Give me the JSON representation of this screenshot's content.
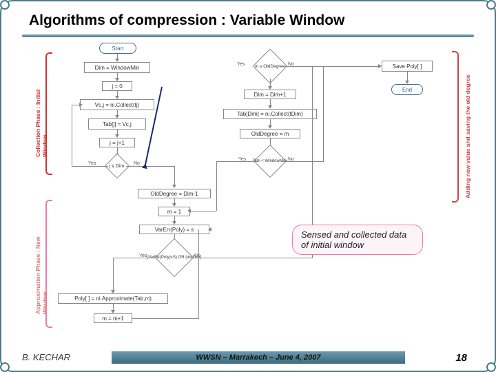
{
  "title": "Algorithms of compression :  Variable Window",
  "side_labels": {
    "collection": "Collection Phase : Initial Window",
    "approximation": "Approximation Phase : New Window",
    "adding": "Adding new value and saving the old degree"
  },
  "nodes": {
    "start": "Start",
    "dim_init": "Dim = WindowMin",
    "j0": "j = 0",
    "vcj": "Vc,j = ni.Collect(tj)",
    "tabj": "Tab[j] = Vc,j",
    "jpp": "j = j+1",
    "jlt": "j ≤ Dim",
    "old1": "OldDegree = Dim-1",
    "m1": "m = 1",
    "varerr": "VarErr(Poly) = s",
    "cond2": "(VarErr(Poly)≤S) OR (m<Dim)",
    "approx": "Poly[ ] = ni.Approximate(Tab,m)",
    "mpp": "m = m+1",
    "mlt": "m ≤ OldDegree",
    "dimpp": "Dim = Dim+1",
    "tabdim": "Tab[Dim] = ni.Collect(tDim)",
    "oldm": "OldDegree = m",
    "dimlt": "Dim < WindowMax",
    "save": "Save Poly[ ]",
    "end": "End"
  },
  "branch": {
    "yes": "Yes",
    "no": "No"
  },
  "callout": "Sensed and collected data of initial window",
  "footer": {
    "author": "B. KECHAR",
    "venue": "WWSN – Marrakech – June 4, 2007",
    "page": "18"
  }
}
